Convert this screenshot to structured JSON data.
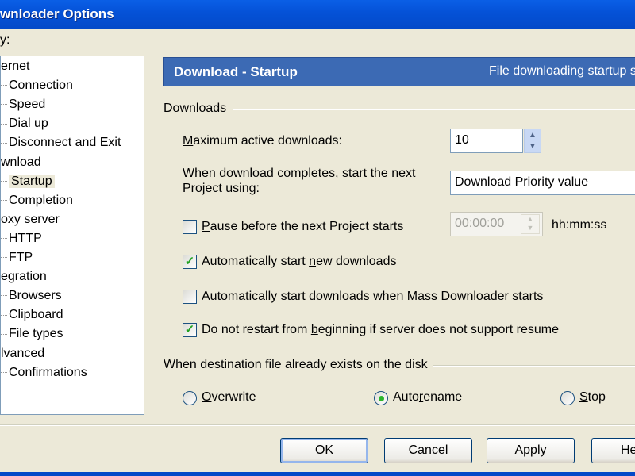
{
  "window": {
    "title": "wnloader Options"
  },
  "category_label": "y:",
  "tree": [
    {
      "label": "ernet",
      "level": 0
    },
    {
      "label": "Connection",
      "level": 1
    },
    {
      "label": "Speed",
      "level": 1
    },
    {
      "label": "Dial up",
      "level": 1
    },
    {
      "label": "Disconnect and Exit",
      "level": 1
    },
    {
      "label": "wnload",
      "level": 0
    },
    {
      "label": "Startup",
      "level": 1,
      "selected": true
    },
    {
      "label": "Completion",
      "level": 1
    },
    {
      "label": "oxy server",
      "level": 0
    },
    {
      "label": "HTTP",
      "level": 1
    },
    {
      "label": "FTP",
      "level": 1
    },
    {
      "label": "egration",
      "level": 0
    },
    {
      "label": "Browsers",
      "level": 1
    },
    {
      "label": "Clipboard",
      "level": 1
    },
    {
      "label": "File types",
      "level": 1
    },
    {
      "label": "lvanced",
      "level": 0
    },
    {
      "label": "Confirmations",
      "level": 1
    }
  ],
  "header": {
    "title": "Download - Startup",
    "description": "File downloading startup s"
  },
  "downloads": {
    "group_label": "Downloads",
    "max_active_label_u": "M",
    "max_active_label": "aximum active downloads:",
    "max_active_value": "10",
    "next_project_label": "When download completes, start the next Project using:",
    "next_project_value": "Download Priority value",
    "pause_label_u": "P",
    "pause_label": "ause before the next Project starts",
    "pause_checked": false,
    "pause_time": "00:00:00",
    "pause_unit": "hh:mm:ss",
    "auto_start_pre": "Automatically start ",
    "auto_start_u": "n",
    "auto_start_post": "ew downloads",
    "auto_start_checked": true,
    "auto_start_md_label": "Automatically start downloads when Mass Downloader starts",
    "auto_start_md_checked": false,
    "no_restart_pre": "Do not restart from ",
    "no_restart_u": "b",
    "no_restart_post": "eginning if server does not support resume",
    "no_restart_checked": true
  },
  "exists": {
    "group_label": "When destination file already exists on the disk",
    "options": [
      {
        "u": "O",
        "rest": "verwrite"
      },
      {
        "pre": "Auto",
        "u": "r",
        "rest": "ename"
      },
      {
        "u": "S",
        "rest": "top"
      }
    ],
    "selected": "Autorename"
  },
  "buttons": {
    "ok": "OK",
    "cancel": "Cancel",
    "apply": "Apply",
    "help": "He"
  },
  "colors": {
    "titlebar": "#0552d8",
    "header": "#3c6ab4",
    "face": "#ece9d8"
  }
}
